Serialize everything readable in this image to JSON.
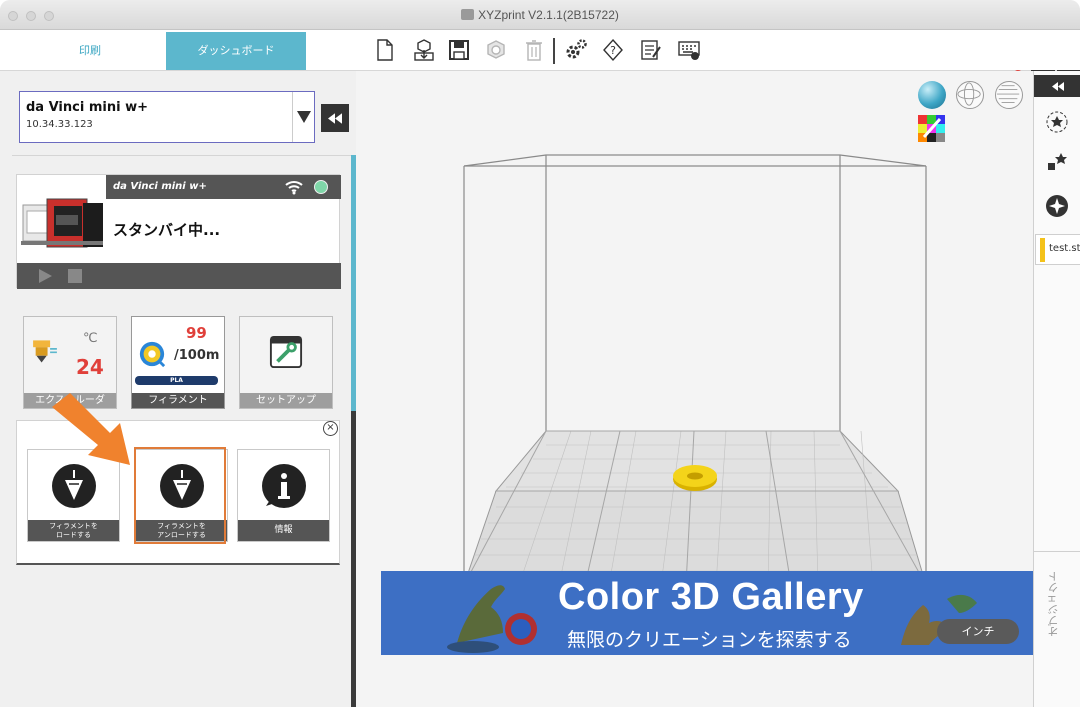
{
  "window": {
    "title": "XYZprint V2.1.1(2B15722)"
  },
  "tabs": {
    "print": "印刷",
    "dashboard": "ダッシュボード"
  },
  "toolbar": {
    "tools": [
      "new-file-icon",
      "import-icon",
      "save-icon",
      "export-icon",
      "trash-icon",
      "settings-icon",
      "help-icon",
      "notes-icon",
      "keyboard-icon"
    ]
  },
  "printer": {
    "name": "da Vinci mini w+",
    "ip": "10.34.33.123",
    "model": "da Vinci mini w+",
    "status": "スタンバイ中..."
  },
  "tiles": {
    "extruder_label": "エクストルーダ",
    "temp_unit": "℃",
    "temp_value": "24",
    "filament_count": "99",
    "filament_total": "/100m",
    "filament_type": "PLA",
    "filament_label": "フィラメント",
    "setup_label": "セットアップ"
  },
  "actions": {
    "close": "×",
    "load": "フィラメントを\nロードする",
    "unload": "フィラメントを\nアンロードする",
    "info": "情報"
  },
  "banner": {
    "title": "Color 3D Gallery",
    "subtitle": "無限のクリエーションを探索する",
    "button": "インチ"
  },
  "object_panel": {
    "item": "test.stl",
    "label": "オブジェクト"
  },
  "colors": {
    "accent": "#5cb7cd",
    "highlight": "#e07b39",
    "banner": "#3d6fc4",
    "temp": "#e0403a"
  }
}
